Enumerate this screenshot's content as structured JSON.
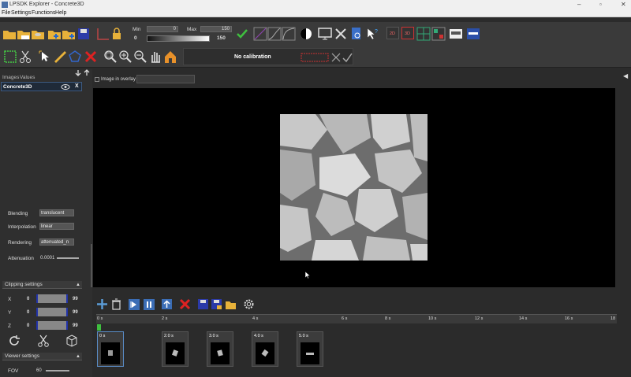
{
  "window": {
    "title": "LPSDK Explorer - Concrete3D"
  },
  "menu": {
    "file": "File",
    "settings": "Settings",
    "functions": "Functions",
    "help": "Help"
  },
  "window_controls": {
    "minimize": "–",
    "maximize": "▫",
    "close": "✕"
  },
  "range": {
    "min_label": "Min",
    "max_label": "Max",
    "min_value": "0",
    "max_value": "150",
    "min_slider": "0",
    "max_slider": "150"
  },
  "toolbar": {
    "view_2d": "2D",
    "view_3d": "3D"
  },
  "calibration": {
    "label": "No calibration"
  },
  "left_panel": {
    "tabs": {
      "images": "Images",
      "values": "Values"
    },
    "overlay_label": "Image in overlay",
    "layer": {
      "name": "Concrete3D",
      "close": "X"
    },
    "render": {
      "blending_label": "Blending",
      "blending_value": "translucent",
      "interpolation_label": "Interpolation",
      "interpolation_value": "linear",
      "rendering_label": "Rendering",
      "rendering_value": "attenuated_n",
      "attenuation_label": "Attenuation",
      "attenuation_value": "0.0001"
    },
    "clipping": {
      "title": "Clipping settings",
      "x_label": "X",
      "x_min": "0",
      "x_max": "99",
      "y_label": "Y",
      "y_min": "0",
      "y_max": "99",
      "z_label": "Z",
      "z_min": "0",
      "z_max": "99"
    },
    "viewer": {
      "title": "Viewer settings",
      "fov_label": "FOV",
      "fov_value": "60"
    }
  },
  "timeline": {
    "ticks": [
      "0 s",
      "2 s",
      "4 s",
      "6 s",
      "8 s",
      "10 s",
      "12 s",
      "14 s",
      "16 s",
      "18"
    ],
    "keyframes": [
      {
        "label": "0 s",
        "selected": true
      },
      {
        "label": "2.0 s",
        "selected": false
      },
      {
        "label": "3.0 s",
        "selected": false
      },
      {
        "label": "4.0 s",
        "selected": false
      },
      {
        "label": "5.0 s",
        "selected": false
      }
    ]
  },
  "colors": {
    "accent": "#3d5a80",
    "background": "#2b2b2b",
    "viewport": "#000000"
  }
}
